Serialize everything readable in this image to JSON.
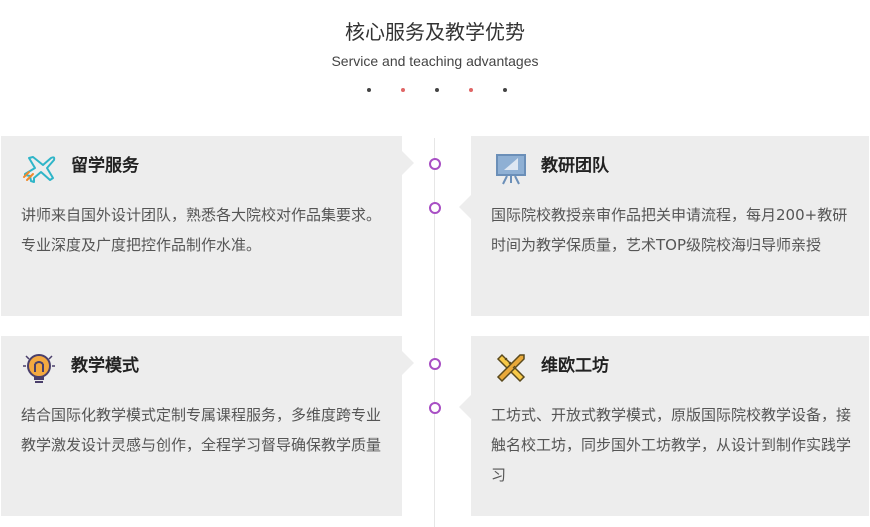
{
  "section": {
    "title": "核心服务及教学优势",
    "subtitle": "Service and teaching advantages"
  },
  "colors": {
    "card_bg": "#ededed",
    "timeline_dot": "#a84fc4",
    "dot_dark": "#444444",
    "dot_accent": "#e06666"
  },
  "cards": [
    {
      "title": "留学服务",
      "icon": "airplane-icon",
      "text": "讲师来自国外设计团队，熟悉各大院校对作品集要求。专业深度及广度把控作品制作水准。"
    },
    {
      "title": "教研团队",
      "icon": "presentation-board-icon",
      "text": "国际院校教授亲审作品把关申请流程，每月200+教研时间为教学保质量，艺术TOP级院校海归导师亲授"
    },
    {
      "title": "教学模式",
      "icon": "lightbulb-icon",
      "text": "结合国际化教学模式定制专属课程服务，多维度跨专业教学激发设计灵感与创作，全程学习督导确保教学质量"
    },
    {
      "title": "维欧工坊",
      "icon": "tools-icon",
      "text": "工坊式、开放式教学模式，原版国际院校教学设备，接触名校工坊，同步国外工坊教学，从设计到制作实践学习"
    }
  ]
}
